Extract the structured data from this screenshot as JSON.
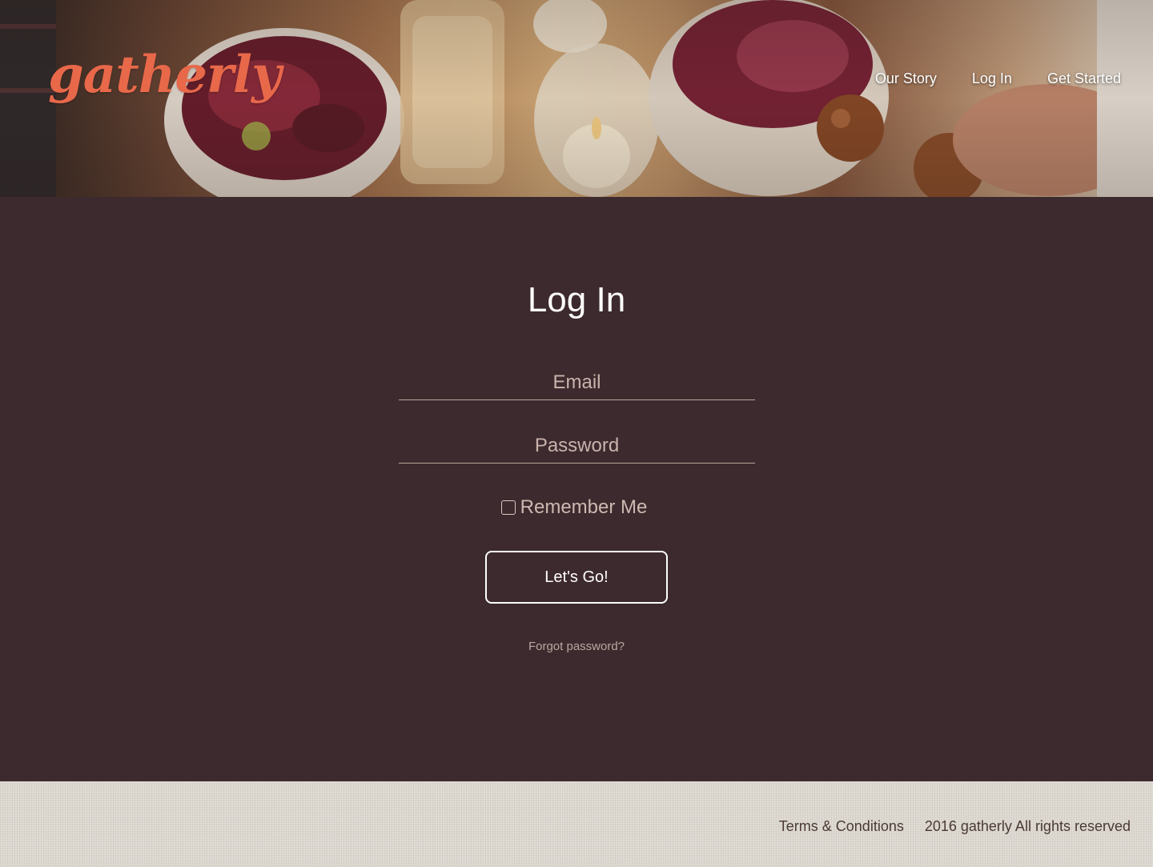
{
  "header": {
    "logo": "gatherly",
    "nav": [
      {
        "label": "Our Story"
      },
      {
        "label": "Log In"
      },
      {
        "label": "Get Started"
      }
    ]
  },
  "login": {
    "title": "Log In",
    "email_placeholder": "Email",
    "password_placeholder": "Password",
    "remember_label": "Remember Me",
    "remember_checked": false,
    "submit_label": "Let's Go!",
    "forgot_label": "Forgot password?"
  },
  "footer": {
    "terms_label": "Terms & Conditions",
    "copyright": "2016 gatherly All rights reserved"
  },
  "colors": {
    "logo": "#e8684a",
    "main_background": "#3d2a2e",
    "footer_background": "#dcd7cf"
  }
}
